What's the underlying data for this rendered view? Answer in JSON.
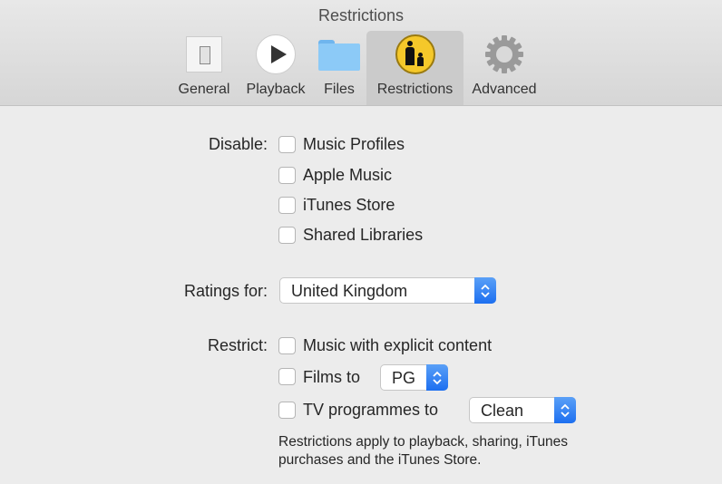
{
  "window": {
    "title": "Restrictions"
  },
  "tabs": [
    {
      "label": "General",
      "icon": "switch-icon"
    },
    {
      "label": "Playback",
      "icon": "play-icon"
    },
    {
      "label": "Files",
      "icon": "folder-icon"
    },
    {
      "label": "Restrictions",
      "icon": "parental-icon",
      "selected": true
    },
    {
      "label": "Advanced",
      "icon": "gear-icon"
    }
  ],
  "disable": {
    "label": "Disable:",
    "options": [
      {
        "label": "Music Profiles",
        "checked": false
      },
      {
        "label": "Apple Music",
        "checked": false
      },
      {
        "label": "iTunes Store",
        "checked": false
      },
      {
        "label": "Shared Libraries",
        "checked": false
      }
    ]
  },
  "ratings": {
    "label": "Ratings for:",
    "value": "United Kingdom"
  },
  "restrict": {
    "label": "Restrict:",
    "explicit": {
      "label": "Music with explicit content",
      "checked": false
    },
    "films": {
      "label": "Films to",
      "checked": false,
      "value": "PG"
    },
    "tv": {
      "label": "TV programmes to",
      "checked": false,
      "value": "Clean"
    }
  },
  "note": {
    "line1": "Restrictions apply to playback, sharing, iTunes",
    "line2": "purchases and the iTunes Store."
  },
  "colors": {
    "accent": "#1d6ff0",
    "selected_tab": "#cbcbcb"
  }
}
